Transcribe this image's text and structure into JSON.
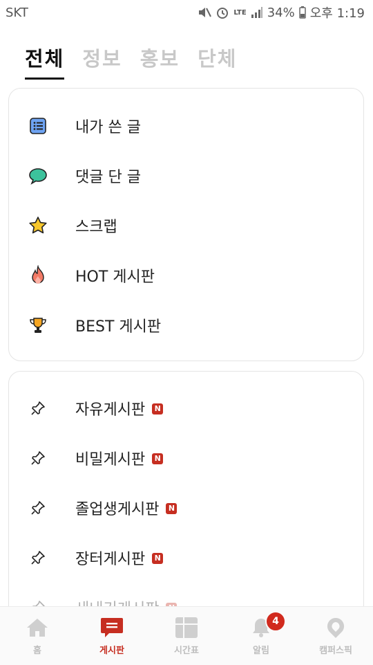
{
  "status": {
    "carrier": "SKT",
    "network": "LTE",
    "battery": "34%",
    "time": "오후 1:19"
  },
  "tabs": [
    {
      "label": "전체",
      "active": true
    },
    {
      "label": "정보",
      "active": false
    },
    {
      "label": "홍보",
      "active": false
    },
    {
      "label": "단체",
      "active": false
    }
  ],
  "my_menu": [
    {
      "label": "내가 쓴 글",
      "icon": "list-icon"
    },
    {
      "label": "댓글 단 글",
      "icon": "comment-icon"
    },
    {
      "label": "스크랩",
      "icon": "star-icon"
    },
    {
      "label": "HOT 게시판",
      "icon": "fire-icon"
    },
    {
      "label": "BEST 게시판",
      "icon": "trophy-icon"
    }
  ],
  "boards": [
    {
      "label": "자유게시판",
      "new_badge": "N"
    },
    {
      "label": "비밀게시판",
      "new_badge": "N"
    },
    {
      "label": "졸업생게시판",
      "new_badge": "N"
    },
    {
      "label": "장터게시판",
      "new_badge": "N"
    },
    {
      "label": "새내기게시판",
      "new_badge": "N"
    }
  ],
  "bottom_nav": [
    {
      "label": "홈",
      "icon": "home-icon",
      "active": false
    },
    {
      "label": "게시판",
      "icon": "board-icon",
      "active": true
    },
    {
      "label": "시간표",
      "icon": "timetable-icon",
      "active": false
    },
    {
      "label": "알림",
      "icon": "bell-icon",
      "active": false,
      "badge": "4"
    },
    {
      "label": "캠퍼스픽",
      "icon": "campuspick-icon",
      "active": false
    }
  ],
  "colors": {
    "accent": "#c62e21",
    "inactive": "#c8c8c8"
  }
}
